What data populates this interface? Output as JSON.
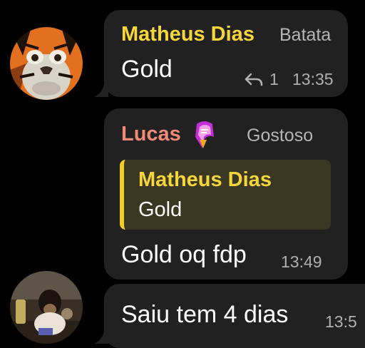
{
  "messages": [
    {
      "sender": "Matheus Dias",
      "sender_color": "#f6d63a",
      "tag": "Batata",
      "text": "Gold",
      "reply_count": "1",
      "time": "13:35",
      "avatar": "tiger-face-avatar"
    },
    {
      "sender": "Lucas",
      "sender_color": "#f08a76",
      "tag": "Gostoso",
      "sender_emoji": "sticker-emoji-icon",
      "quote": {
        "name": "Matheus Dias",
        "text": "Gold"
      },
      "text": "Gold oq fdp",
      "time": "13:49"
    },
    {
      "text": "Saiu tem 4 dias",
      "time": "13:5",
      "avatar": "dog-photo-avatar"
    }
  ],
  "colors": {
    "background": "#000000",
    "bubble": "#212121",
    "quote_bar": "#f3cd2a",
    "quote_bg": "#3a3823"
  }
}
